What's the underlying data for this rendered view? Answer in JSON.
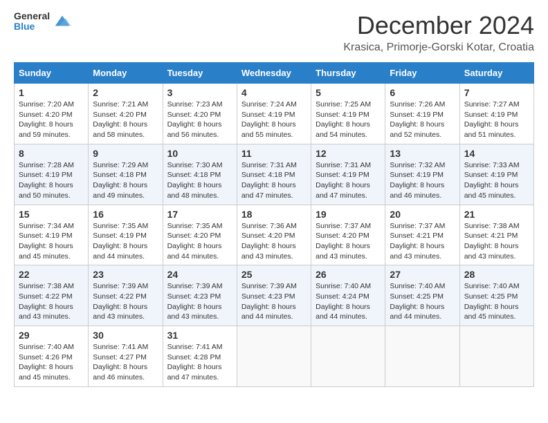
{
  "header": {
    "logo_general": "General",
    "logo_blue": "Blue",
    "month_title": "December 2024",
    "location": "Krasica, Primorje-Gorski Kotar, Croatia"
  },
  "days_of_week": [
    "Sunday",
    "Monday",
    "Tuesday",
    "Wednesday",
    "Thursday",
    "Friday",
    "Saturday"
  ],
  "weeks": [
    [
      {
        "day": "1",
        "sunrise": "7:20 AM",
        "sunset": "4:20 PM",
        "daylight": "8 hours and 59 minutes."
      },
      {
        "day": "2",
        "sunrise": "7:21 AM",
        "sunset": "4:20 PM",
        "daylight": "8 hours and 58 minutes."
      },
      {
        "day": "3",
        "sunrise": "7:23 AM",
        "sunset": "4:20 PM",
        "daylight": "8 hours and 56 minutes."
      },
      {
        "day": "4",
        "sunrise": "7:24 AM",
        "sunset": "4:19 PM",
        "daylight": "8 hours and 55 minutes."
      },
      {
        "day": "5",
        "sunrise": "7:25 AM",
        "sunset": "4:19 PM",
        "daylight": "8 hours and 54 minutes."
      },
      {
        "day": "6",
        "sunrise": "7:26 AM",
        "sunset": "4:19 PM",
        "daylight": "8 hours and 52 minutes."
      },
      {
        "day": "7",
        "sunrise": "7:27 AM",
        "sunset": "4:19 PM",
        "daylight": "8 hours and 51 minutes."
      }
    ],
    [
      {
        "day": "8",
        "sunrise": "7:28 AM",
        "sunset": "4:19 PM",
        "daylight": "8 hours and 50 minutes."
      },
      {
        "day": "9",
        "sunrise": "7:29 AM",
        "sunset": "4:18 PM",
        "daylight": "8 hours and 49 minutes."
      },
      {
        "day": "10",
        "sunrise": "7:30 AM",
        "sunset": "4:18 PM",
        "daylight": "8 hours and 48 minutes."
      },
      {
        "day": "11",
        "sunrise": "7:31 AM",
        "sunset": "4:18 PM",
        "daylight": "8 hours and 47 minutes."
      },
      {
        "day": "12",
        "sunrise": "7:31 AM",
        "sunset": "4:19 PM",
        "daylight": "8 hours and 47 minutes."
      },
      {
        "day": "13",
        "sunrise": "7:32 AM",
        "sunset": "4:19 PM",
        "daylight": "8 hours and 46 minutes."
      },
      {
        "day": "14",
        "sunrise": "7:33 AM",
        "sunset": "4:19 PM",
        "daylight": "8 hours and 45 minutes."
      }
    ],
    [
      {
        "day": "15",
        "sunrise": "7:34 AM",
        "sunset": "4:19 PM",
        "daylight": "8 hours and 45 minutes."
      },
      {
        "day": "16",
        "sunrise": "7:35 AM",
        "sunset": "4:19 PM",
        "daylight": "8 hours and 44 minutes."
      },
      {
        "day": "17",
        "sunrise": "7:35 AM",
        "sunset": "4:20 PM",
        "daylight": "8 hours and 44 minutes."
      },
      {
        "day": "18",
        "sunrise": "7:36 AM",
        "sunset": "4:20 PM",
        "daylight": "8 hours and 43 minutes."
      },
      {
        "day": "19",
        "sunrise": "7:37 AM",
        "sunset": "4:20 PM",
        "daylight": "8 hours and 43 minutes."
      },
      {
        "day": "20",
        "sunrise": "7:37 AM",
        "sunset": "4:21 PM",
        "daylight": "8 hours and 43 minutes."
      },
      {
        "day": "21",
        "sunrise": "7:38 AM",
        "sunset": "4:21 PM",
        "daylight": "8 hours and 43 minutes."
      }
    ],
    [
      {
        "day": "22",
        "sunrise": "7:38 AM",
        "sunset": "4:22 PM",
        "daylight": "8 hours and 43 minutes."
      },
      {
        "day": "23",
        "sunrise": "7:39 AM",
        "sunset": "4:22 PM",
        "daylight": "8 hours and 43 minutes."
      },
      {
        "day": "24",
        "sunrise": "7:39 AM",
        "sunset": "4:23 PM",
        "daylight": "8 hours and 43 minutes."
      },
      {
        "day": "25",
        "sunrise": "7:39 AM",
        "sunset": "4:23 PM",
        "daylight": "8 hours and 44 minutes."
      },
      {
        "day": "26",
        "sunrise": "7:40 AM",
        "sunset": "4:24 PM",
        "daylight": "8 hours and 44 minutes."
      },
      {
        "day": "27",
        "sunrise": "7:40 AM",
        "sunset": "4:25 PM",
        "daylight": "8 hours and 44 minutes."
      },
      {
        "day": "28",
        "sunrise": "7:40 AM",
        "sunset": "4:25 PM",
        "daylight": "8 hours and 45 minutes."
      }
    ],
    [
      {
        "day": "29",
        "sunrise": "7:40 AM",
        "sunset": "4:26 PM",
        "daylight": "8 hours and 45 minutes."
      },
      {
        "day": "30",
        "sunrise": "7:41 AM",
        "sunset": "4:27 PM",
        "daylight": "8 hours and 46 minutes."
      },
      {
        "day": "31",
        "sunrise": "7:41 AM",
        "sunset": "4:28 PM",
        "daylight": "8 hours and 47 minutes."
      },
      null,
      null,
      null,
      null
    ]
  ],
  "labels": {
    "sunrise": "Sunrise:",
    "sunset": "Sunset:",
    "daylight": "Daylight:"
  }
}
